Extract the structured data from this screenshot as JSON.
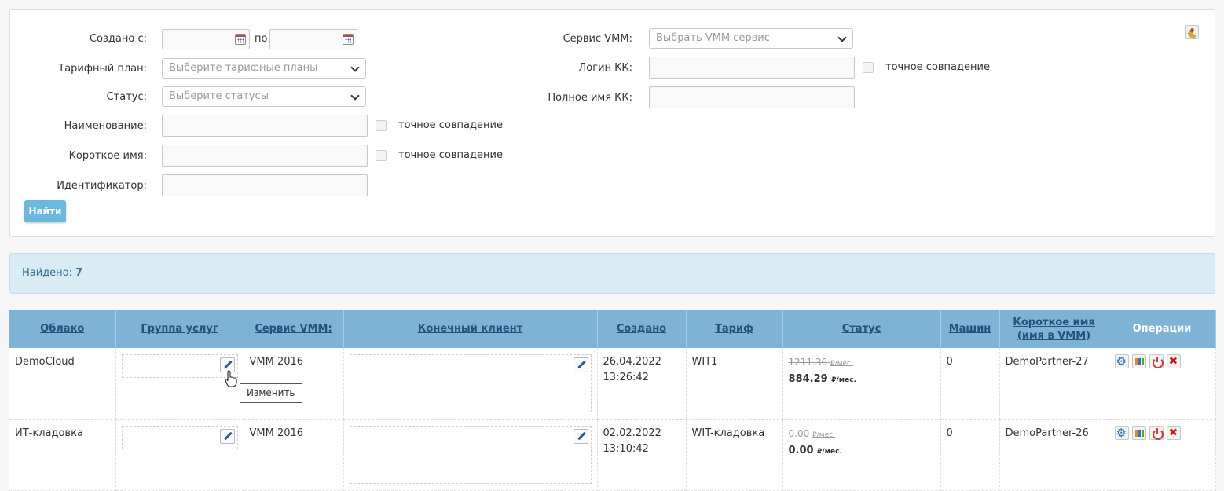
{
  "filters": {
    "created_from_label": "Создано с:",
    "created_to_label": "по",
    "tariff_label": "Тарифный план:",
    "tariff_placeholder": "Выберите тарифные планы",
    "status_label": "Статус:",
    "status_placeholder": "Выберите статусы",
    "name_label": "Наименование:",
    "short_name_label": "Короткое имя:",
    "identifier_label": "Идентификатор:",
    "exact_match_label": "точное совпадение",
    "vmm_service_label": "Сервис VMM:",
    "vmm_service_placeholder": "Выбрать VMM сервис",
    "kk_login_label": "Логин КК:",
    "kk_fullname_label": "Полное имя КК:",
    "find_button": "Найти"
  },
  "found": {
    "label": "Найдено:",
    "count": "7"
  },
  "table": {
    "headers": {
      "cloud": "Облако",
      "service_group": "Группа услуг",
      "vmm_service": "Сервис VMM:",
      "end_client": "Конечный клиент",
      "created": "Создано",
      "tariff": "Тариф",
      "status": "Статус",
      "machines": "Машин",
      "short_name_1": "Короткое имя",
      "short_name_2": "(имя в VMM)",
      "operations": "Операции"
    },
    "rows": [
      {
        "cloud": "DemoCloud",
        "vmm_service": "VMM 2016",
        "created_date": "26.04.2022",
        "created_time": "13:26:42",
        "tariff": "WIT1",
        "old_price": "1211.36",
        "new_price": "884.29",
        "price_unit": "₽/мес.",
        "machines": "0",
        "short_name": "DemoPartner-27"
      },
      {
        "cloud": "ИТ-кладовка",
        "vmm_service": "VMM 2016",
        "created_date": "02.02.2022",
        "created_time": "13:10:42",
        "tariff": "WIT-кладовка",
        "old_price": "0.00",
        "new_price": "0.00",
        "price_unit": "₽/мес.",
        "machines": "0",
        "short_name": "DemoPartner-26"
      }
    ]
  },
  "tooltip": {
    "text": "Изменить"
  }
}
